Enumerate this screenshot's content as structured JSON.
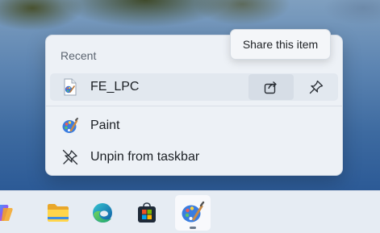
{
  "jump_list": {
    "section_label": "Recent",
    "recent_items": [
      {
        "label": "FE_LPC",
        "icon": "paint-file-icon"
      }
    ],
    "recent_actions": {
      "share_icon": "share-icon",
      "pin_icon": "pin-icon"
    },
    "tasks": [
      {
        "label": "Paint",
        "icon": "paint-icon"
      },
      {
        "label": "Unpin from taskbar",
        "icon": "unpin-icon"
      }
    ]
  },
  "tooltip": {
    "text": "Share this item"
  },
  "taskbar": {
    "apps": [
      {
        "name": "copilot",
        "icon": "copilot-icon"
      },
      {
        "name": "file-explorer",
        "icon": "folder-icon"
      },
      {
        "name": "edge",
        "icon": "edge-icon"
      },
      {
        "name": "store",
        "icon": "store-icon"
      },
      {
        "name": "paint",
        "icon": "paint-icon",
        "active": true
      }
    ]
  },
  "colors": {
    "menu_background": "#edf1f6",
    "taskbar_background": "#e6ecf3",
    "hover_row": "#e2e8ef",
    "share_button_pressed": "#d6dde6"
  }
}
